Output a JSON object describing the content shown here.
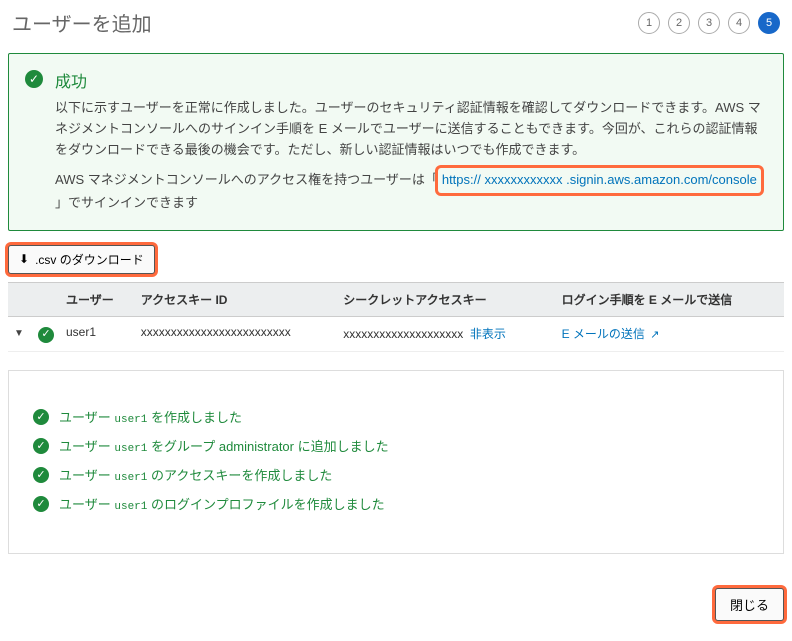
{
  "header": {
    "title": "ユーザーを追加",
    "steps": [
      "1",
      "2",
      "3",
      "4",
      "5"
    ],
    "active_step": 5
  },
  "success": {
    "heading": "成功",
    "para1": "以下に示すユーザーを正常に作成しました。ユーザーのセキュリティ認証情報を確認してダウンロードできます。AWS マネジメントコンソールへのサインイン手順を E メールでユーザーに送信することもできます。今回が、これらの認証情報をダウンロードできる最後の機会です。ただし、新しい認証情報はいつでも作成できます。",
    "para2_pre": "AWS マネジメントコンソールへのアクセス権を持つユーザーは「",
    "signin_url": "https://   xxxxxxxxxxxx  .signin.aws.amazon.com/console",
    "para2_post": "」でサインインできます"
  },
  "csv_download_label": ".csv のダウンロード",
  "table": {
    "headers": {
      "user": "ユーザー",
      "access_key": "アクセスキー ID",
      "secret": "シークレットアクセスキー",
      "email": "ログイン手順を E メールで送信"
    },
    "row": {
      "username": "user1",
      "access_key_id": "xxxxxxxxxxxxxxxxxxxxxxxxx",
      "secret_masked": "xxxxxxxxxxxxxxxxxxxx",
      "secret_toggle": "非表示",
      "send_email": "E メールの送信"
    }
  },
  "details": {
    "username": "user1",
    "lines": {
      "created_pre": "ユーザー",
      "created_post": "を作成しました",
      "group_pre": "ユーザー",
      "group_mid": "をグループ administrator に追加しました",
      "ak_pre": "ユーザー",
      "ak_post": "のアクセスキーを作成しました",
      "lp_pre": "ユーザー",
      "lp_post": "のログインプロファイルを作成しました"
    }
  },
  "footer": {
    "close": "閉じる"
  }
}
